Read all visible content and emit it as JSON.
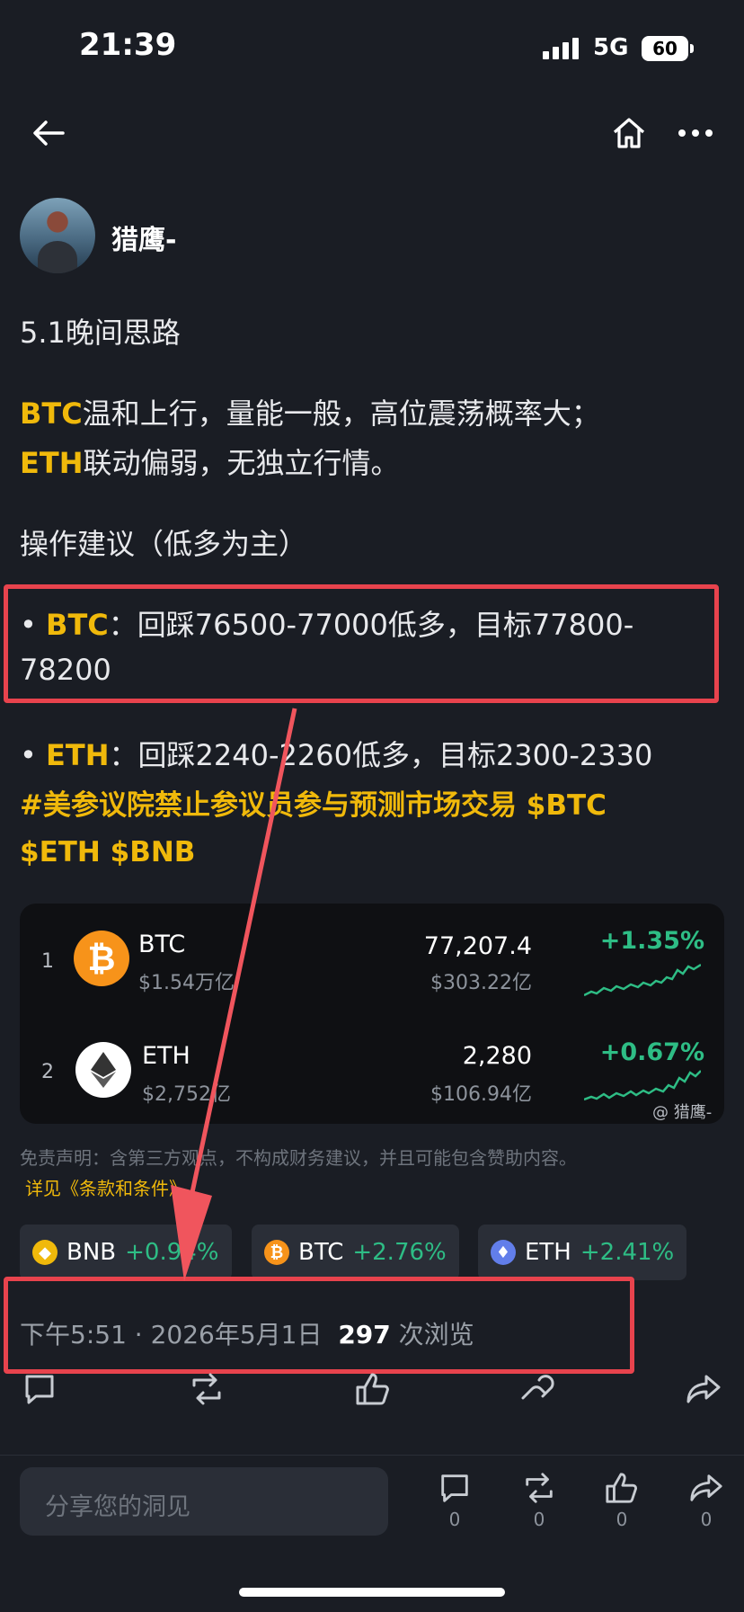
{
  "status_bar": {
    "time": "21:39",
    "network": "5G",
    "battery": "60"
  },
  "author": {
    "name": "猎鹰-"
  },
  "post": {
    "title": "5.1晚间思路",
    "line1_ticker": "BTC",
    "line1_text": "温和上行，量能一般，高位震荡概率大；",
    "line2_ticker": "ETH",
    "line2_text": "联动偏弱，无独立行情。",
    "advice_heading": "操作建议（低多为主）",
    "btc_bullet": "•",
    "btc_ticker": "BTC",
    "btc_text_1": "：回踩76500-77000低多，目标77800-",
    "btc_text_2": "78200",
    "eth_bullet": "•",
    "eth_ticker": "ETH",
    "eth_text": "：回踩2240-2260低多，目标2300-2330",
    "tags_line1": "#美参议院禁止参议员参与预测市场交易 $BTC",
    "tags_line2": "$ETH $BNB"
  },
  "market_card": {
    "rows": [
      {
        "rank": "1",
        "name": "BTC",
        "market_cap": "$1.54万亿",
        "price": "77,207.4",
        "volume": "$303.22亿",
        "change": "+1.35%",
        "icon": "bitcoin-icon",
        "color": "#f7931a"
      },
      {
        "rank": "2",
        "name": "ETH",
        "market_cap": "$2,752亿",
        "price": "2,280",
        "volume": "$106.94亿",
        "change": "+0.67%",
        "icon": "ethereum-icon",
        "color": "#ffffff"
      }
    ],
    "watermark": "@ 猎鹰-"
  },
  "disclaimer": "免责声明：含第三方观点，不构成财务建议，并且可能包含赞助内容。",
  "terms_link": "详见《条款和条件》",
  "chips": [
    {
      "name": "BNB",
      "change": "+0.94%",
      "color": "#f0b90b"
    },
    {
      "name": "BTC",
      "change": "+2.76%",
      "color": "#f7931a"
    },
    {
      "name": "ETH",
      "change": "+2.41%",
      "color": "#627eea"
    }
  ],
  "meta": {
    "time": "下午5:51",
    "separator": "·",
    "date": "2026年5月1日",
    "views": "297",
    "views_label": "次浏览"
  },
  "comment_input": {
    "placeholder": "分享您的洞见"
  },
  "bottom_counts": {
    "comments": "0",
    "reposts": "0",
    "likes": "0",
    "shares": "0"
  },
  "colors": {
    "accent": "#f0b90b",
    "positive": "#2ebd85",
    "highlight_box": "#e8434d",
    "arrow": "#f0555d"
  }
}
